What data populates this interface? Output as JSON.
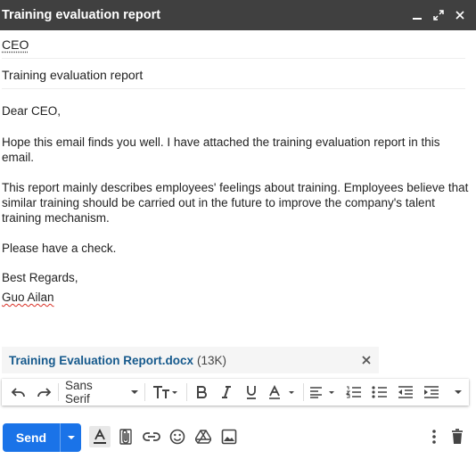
{
  "window": {
    "title": "Training evaluation report"
  },
  "compose": {
    "recipient": "CEO",
    "subject": "Training evaluation report",
    "greeting": "Dear CEO,",
    "paragraph1": "Hope this email finds you well. I have attached the training evaluation report in this email.",
    "paragraph2": "This report mainly describes employees' feelings about training. Employees believe that similar training should be carried out in the future to improve the company's talent training mechanism.",
    "paragraph3": "Please have a check.",
    "closing": "Best Regards,",
    "signature": "Guo Ailan"
  },
  "attachment": {
    "filename": "Training Evaluation Report.docx",
    "size": "(13K)"
  },
  "toolbar": {
    "font_name": "Sans Serif"
  },
  "actions": {
    "send_label": "Send"
  },
  "colors": {
    "title_bar": "#404040",
    "send_button": "#1a73e8",
    "attachment_link": "#15598c",
    "spelling_underline": "#d93025"
  }
}
